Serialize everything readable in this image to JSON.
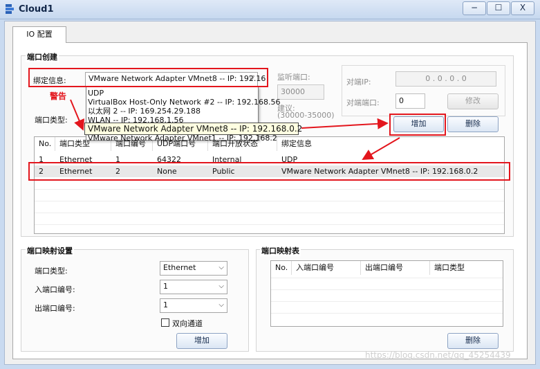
{
  "window": {
    "title": "Cloud1",
    "min_icon": "−",
    "max_icon": "☐",
    "close_icon": "X"
  },
  "tabs": [
    {
      "label": "IO 配置"
    }
  ],
  "port_create": {
    "title": "端口创建",
    "bind_label": "绑定信息:",
    "bind_value": "VMware Network Adapter VMnet8 -- IP: 192.16",
    "port_type_label": "端口类型:",
    "listen_port_label": "监听端口:",
    "listen_port_value": "30000",
    "suggest_label": "建议:",
    "suggest_range": "(30000-35000)",
    "peer_ip_label": "对端IP:",
    "peer_ip_value": "0  .  0  .  0  .  0",
    "peer_port_label": "对端端口:",
    "peer_port_value": "0",
    "modify_button": "修改",
    "add_button": "增加",
    "delete_button": "删除",
    "dropdown_options": [
      "UDP",
      "VirtualBox Host-Only Network #2 -- IP: 192.168.56",
      "以太网 2 -- IP: 169.254.29.188",
      "WLAN -- IP: 192.168.1.56",
      "VMware Network Adapter VMnet1 -- IP: 192.168.2"
    ],
    "tooltip": "VMware Network Adapter VMnet8 -- IP: 192.168.0.2",
    "warning_label": "警告"
  },
  "ports_table": {
    "headers": [
      "No.",
      "端口类型",
      "端口编号",
      "UDP端口号",
      "端口开放状态",
      "绑定信息"
    ],
    "rows": [
      [
        "1",
        "Ethernet",
        "1",
        "64322",
        "Internal",
        "UDP"
      ],
      [
        "2",
        "Ethernet",
        "2",
        "None",
        "Public",
        "VMware Network Adapter VMnet8 -- IP: 192.168.0.2"
      ]
    ]
  },
  "port_map_settings": {
    "title": "端口映射设置",
    "port_type_label": "端口类型:",
    "port_type_value": "Ethernet",
    "in_port_label": "入端口编号:",
    "in_port_value": "1",
    "out_port_label": "出端口编号:",
    "out_port_value": "1",
    "bidirectional_label": "双向通道",
    "add_button": "增加"
  },
  "port_map_table": {
    "title": "端口映射表",
    "headers": [
      "No.",
      "入端口编号",
      "出端口编号",
      "端口类型"
    ],
    "delete_button": "删除"
  },
  "watermark": "https://blog.csdn.net/qq_45254439",
  "colors": {
    "highlight": "#e3161d",
    "selected_row": "#e8e8e8",
    "tooltip_bg": "#ffffe1"
  }
}
